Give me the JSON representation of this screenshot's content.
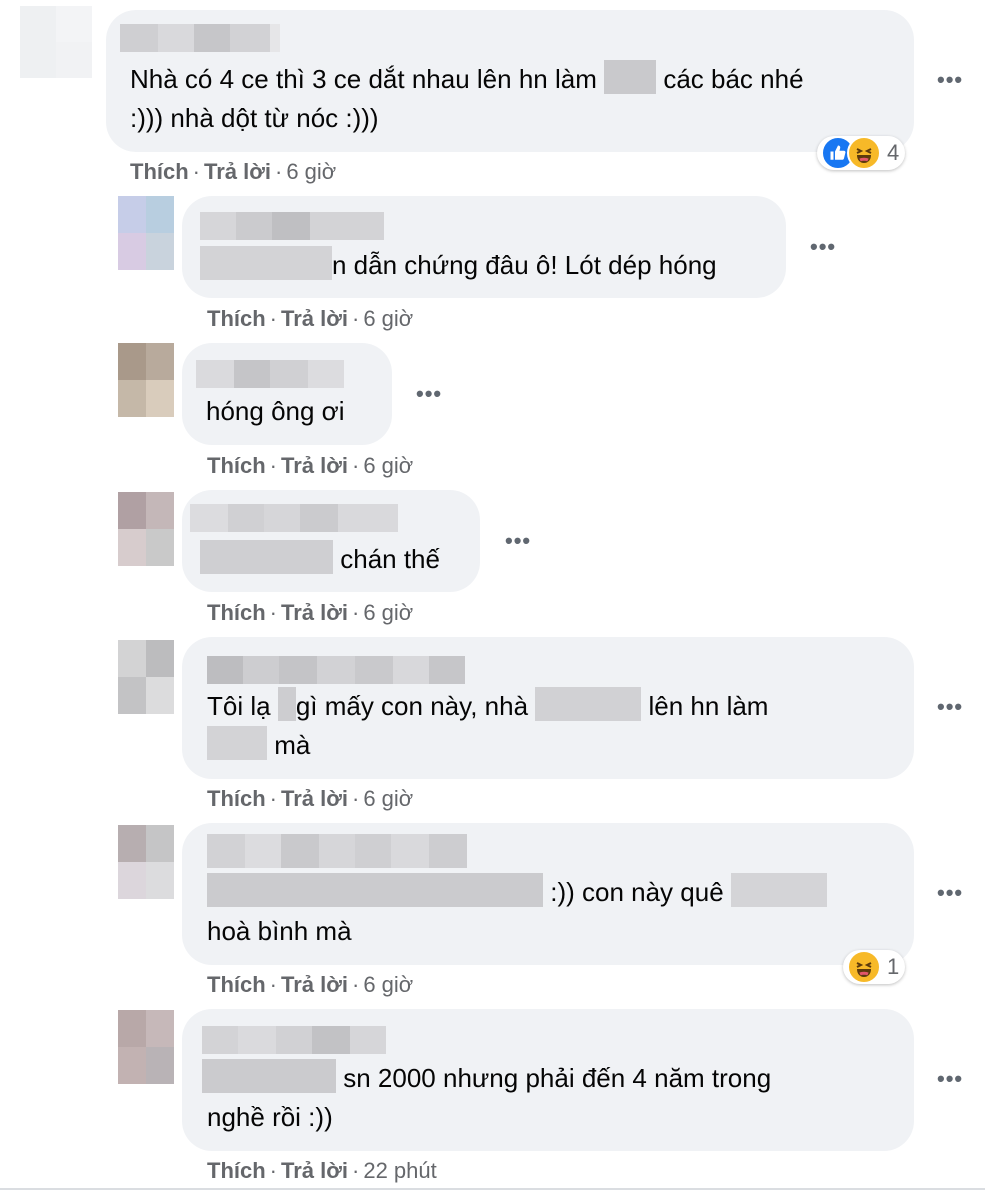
{
  "comments": [
    {
      "text_lines": [
        "Nhà có 4 ce thì 3 ce dắt nhau lên hn làm",
        "các bác nhé",
        ":))) nhà dột từ nóc :)))"
      ],
      "actions": {
        "like": "Thích",
        "reply": "Trả lời",
        "time": "6 giờ"
      },
      "reaction_count": "4",
      "reaction_icons": [
        "like-icon",
        "haha-icon"
      ]
    },
    {
      "text_lines": [
        "n dẫn chứng đâu ô! Lót dép hóng"
      ],
      "actions": {
        "like": "Thích",
        "reply": "Trả lời",
        "time": "6 giờ"
      }
    },
    {
      "text_lines": [
        "hóng ông ơi"
      ],
      "actions": {
        "like": "Thích",
        "reply": "Trả lời",
        "time": "6 giờ"
      }
    },
    {
      "text_lines": [
        "chán thế"
      ],
      "actions": {
        "like": "Thích",
        "reply": "Trả lời",
        "time": "6 giờ"
      }
    },
    {
      "text_lines": [
        "Tôi lạ",
        "gì mấy con này, nhà",
        "lên hn làm",
        "mà"
      ],
      "actions": {
        "like": "Thích",
        "reply": "Trả lời",
        "time": "6 giờ"
      }
    },
    {
      "text_lines": [
        ":)) con này quê",
        "hoà bình mà"
      ],
      "actions": {
        "like": "Thích",
        "reply": "Trả lời",
        "time": "6 giờ"
      },
      "reaction_count": "1",
      "reaction_icons": [
        "haha-icon"
      ]
    },
    {
      "text_lines": [
        "sn 2000 nhưng phải đến 4 năm trong",
        "nghề rồi :))"
      ],
      "actions": {
        "like": "Thích",
        "reply": "Trả lời",
        "time": "22 phút"
      }
    }
  ],
  "more_label": "•••",
  "colors": {
    "bubble": "#f0f2f5",
    "meta": "#65676b",
    "like_blue": "#1877f2",
    "haha_yellow": "#f7b928"
  }
}
